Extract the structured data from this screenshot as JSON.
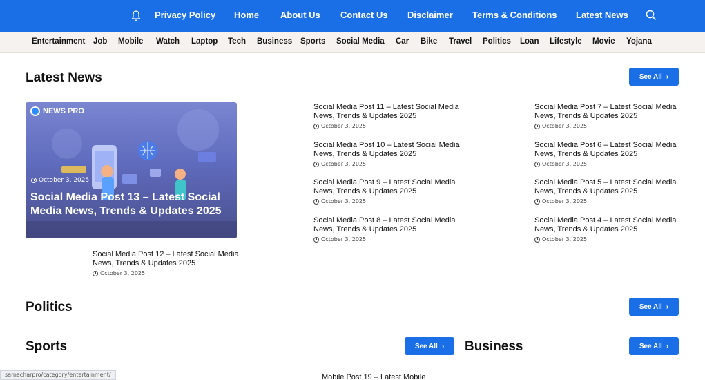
{
  "topnav": {
    "items": [
      "Privacy Policy",
      "Home",
      "About Us",
      "Contact Us",
      "Disclaimer",
      "Terms & Conditions",
      "Latest News"
    ],
    "icons": {
      "bell": "bell-icon",
      "search": "search-icon"
    },
    "bg": "#1a6fe6"
  },
  "categories": [
    "Entertainment",
    "Job",
    "Mobile",
    "Watch",
    "Laptop",
    "Tech",
    "Business",
    "Sports",
    "Social Media",
    "Car",
    "Bike",
    "Travel",
    "Politics",
    "Loan",
    "Lifestyle",
    "Movie",
    "Yojana"
  ],
  "latest": {
    "title": "Latest News",
    "see_all": "See All",
    "feature": {
      "brand": "NEWS PRO",
      "date": "October 3, 2025",
      "title": "Social Media Post 13 – Latest Social Media News, Trends & Updates 2025"
    },
    "left_item": {
      "title": "Social Media Post 12 – Latest Social Media News, Trends & Updates 2025",
      "date": "October 3, 2025"
    },
    "middle": [
      {
        "title": "Social Media Post 11 – Latest Social Media News, Trends & Updates 2025",
        "date": "October 3, 2025"
      },
      {
        "title": "Social Media Post 10 – Latest Social Media News, Trends & Updates 2025",
        "date": "October 3, 2025"
      },
      {
        "title": "Social Media Post 9 – Latest Social Media News, Trends & Updates 2025",
        "date": "October 3, 2025"
      },
      {
        "title": "Social Media Post 8 – Latest Social Media News, Trends & Updates 2025",
        "date": "October 3, 2025"
      }
    ],
    "right": [
      {
        "title": "Social Media Post 7 – Latest Social Media News, Trends & Updates 2025",
        "date": "October 3, 2025"
      },
      {
        "title": "Social Media Post 6 – Latest Social Media News, Trends & Updates 2025",
        "date": "October 3, 2025"
      },
      {
        "title": "Social Media Post 5 – Latest Social Media News, Trends & Updates 2025",
        "date": "October 3, 2025"
      },
      {
        "title": "Social Media Post 4 – Latest Social Media News, Trends & Updates 2025",
        "date": "October 3, 2025"
      }
    ]
  },
  "politics": {
    "title": "Politics",
    "see_all": "See All"
  },
  "sports": {
    "title": "Sports",
    "see_all": "See All"
  },
  "business": {
    "title": "Business",
    "see_all": "See All"
  },
  "bottom_item": "Mobile Post 19 – Latest Mobile",
  "status_url": "samacharpro/category/entertainment/"
}
